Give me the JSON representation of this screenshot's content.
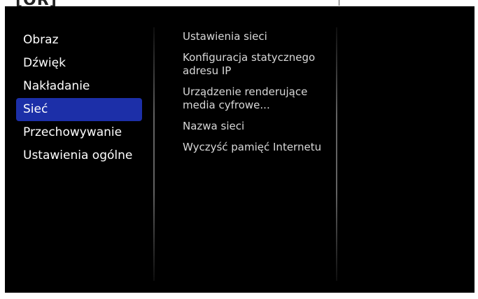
{
  "top_fragment": "[OR]",
  "menu": {
    "items": [
      {
        "label": "Obraz",
        "selected": false
      },
      {
        "label": "Dźwięk",
        "selected": false
      },
      {
        "label": "Nakładanie",
        "selected": false
      },
      {
        "label": "Sieć",
        "selected": true
      },
      {
        "label": "Przechowywanie",
        "selected": false
      },
      {
        "label": "Ustawienia ogólne",
        "selected": false
      }
    ]
  },
  "submenu": {
    "items": [
      {
        "label": "Ustawienia sieci"
      },
      {
        "label": "Konfiguracja statycznego adresu IP"
      },
      {
        "label": "Urządzenie renderujące media cyfrowe..."
      },
      {
        "label": "Nazwa sieci"
      },
      {
        "label": "Wyczyść pamięć Internetu"
      }
    ]
  },
  "colors": {
    "background": "#000000",
    "selection": "#1c2fa8",
    "menu_text": "#ffffff",
    "submenu_text": "#d8d8d8"
  }
}
